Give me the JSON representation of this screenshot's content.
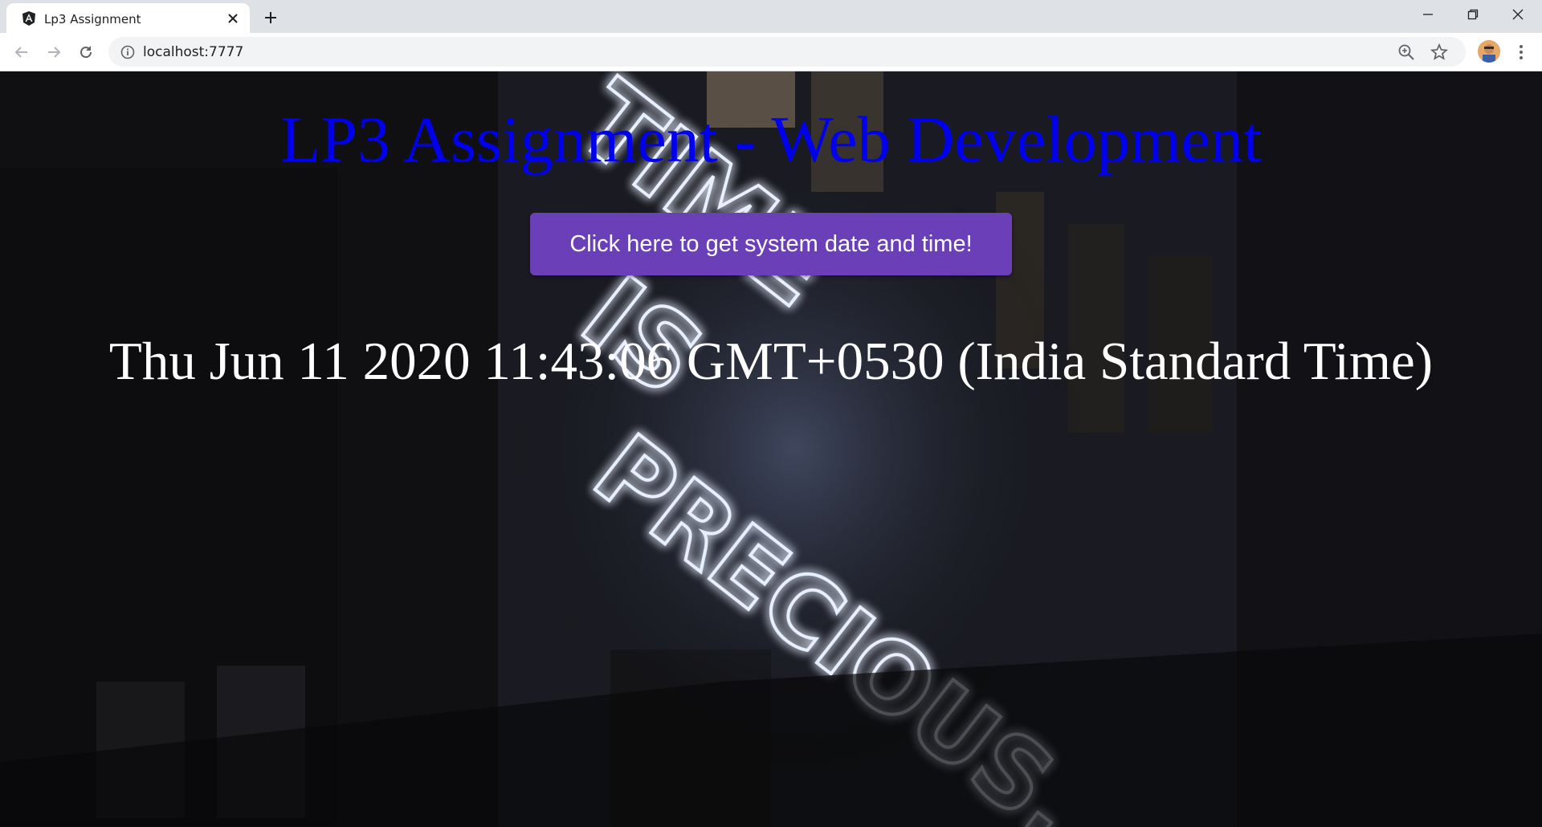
{
  "browser": {
    "tab_title": "Lp3 Assignment",
    "url": "localhost:7777",
    "icons": {
      "favicon": "angular-icon",
      "close_tab": "close-icon",
      "new_tab": "plus-icon",
      "back": "arrow-left-icon",
      "forward": "arrow-right-icon",
      "reload": "reload-icon",
      "site_info": "info-icon",
      "zoom": "zoom-icon",
      "bookmark": "star-icon",
      "profile": "avatar",
      "menu": "kebab-menu-icon",
      "minimize": "minimize-icon",
      "restore": "restore-icon",
      "close_window": "close-icon"
    }
  },
  "page": {
    "title": "LP3 Assignment - Web Development",
    "button_label": "Click here to get system date and time!",
    "datetime": "Thu Jun 11 2020 11:43:06 GMT+0530 (India Standard Time)",
    "background_sign_text": [
      "TIME",
      "IS",
      "PRECIOUS."
    ],
    "colors": {
      "title": "#0000ee",
      "button": "#6a3fb8",
      "datetime": "#ffffff"
    }
  }
}
